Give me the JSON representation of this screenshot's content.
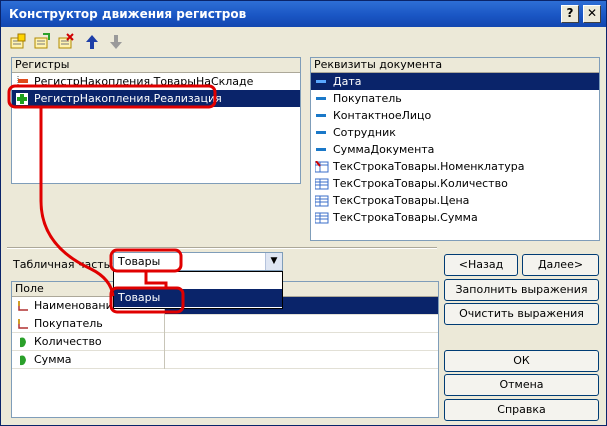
{
  "window": {
    "title": "Конструктор движения регистров",
    "help_glyph": "?",
    "close_glyph": "✕"
  },
  "registers": {
    "header": "Регистры",
    "items": [
      {
        "label": "РегистрНакопления.ТоварыНаСкладе",
        "icon": "minus-register-icon"
      },
      {
        "label": "РегистрНакопления.Реализация",
        "icon": "plus-register-icon"
      }
    ]
  },
  "doc_attrs": {
    "header": "Реквизиты документа",
    "items": [
      {
        "label": "Дата",
        "icon": "attribute-icon"
      },
      {
        "label": "Покупатель",
        "icon": "attribute-icon"
      },
      {
        "label": "КонтактноеЛицо",
        "icon": "attribute-icon"
      },
      {
        "label": "Сотрудник",
        "icon": "attribute-icon"
      },
      {
        "label": "СуммаДокумента",
        "icon": "attribute-icon"
      },
      {
        "label": "ТекСтрокаТовары.Номенклатура",
        "icon": "table-attribute-icon"
      },
      {
        "label": "ТекСтрокаТовары.Количество",
        "icon": "table-attribute-icon"
      },
      {
        "label": "ТекСтрокаТовары.Цена",
        "icon": "table-attribute-icon"
      },
      {
        "label": "ТекСтрокаТовары.Сумма",
        "icon": "table-attribute-icon"
      }
    ]
  },
  "tabular": {
    "label": "Табличная часть:",
    "value": "Товары",
    "dropdown_options": [
      "",
      "Товары"
    ]
  },
  "fields": {
    "header": "Поле",
    "rows": [
      {
        "label": "Наименование",
        "icon": "dimension-icon"
      },
      {
        "label": "Покупатель",
        "icon": "dimension-icon"
      },
      {
        "label": "Количество",
        "icon": "resource-icon"
      },
      {
        "label": "Сумма",
        "icon": "resource-icon"
      }
    ]
  },
  "buttons": {
    "back": "<Назад",
    "next": "Далее>",
    "fill": "Заполнить выражения",
    "clear": "Очистить выражения",
    "ok": "ОК",
    "cancel": "Отмена",
    "help": "Справка"
  },
  "colors": {
    "selection": "#0a246a",
    "annotation": "#e00000"
  }
}
